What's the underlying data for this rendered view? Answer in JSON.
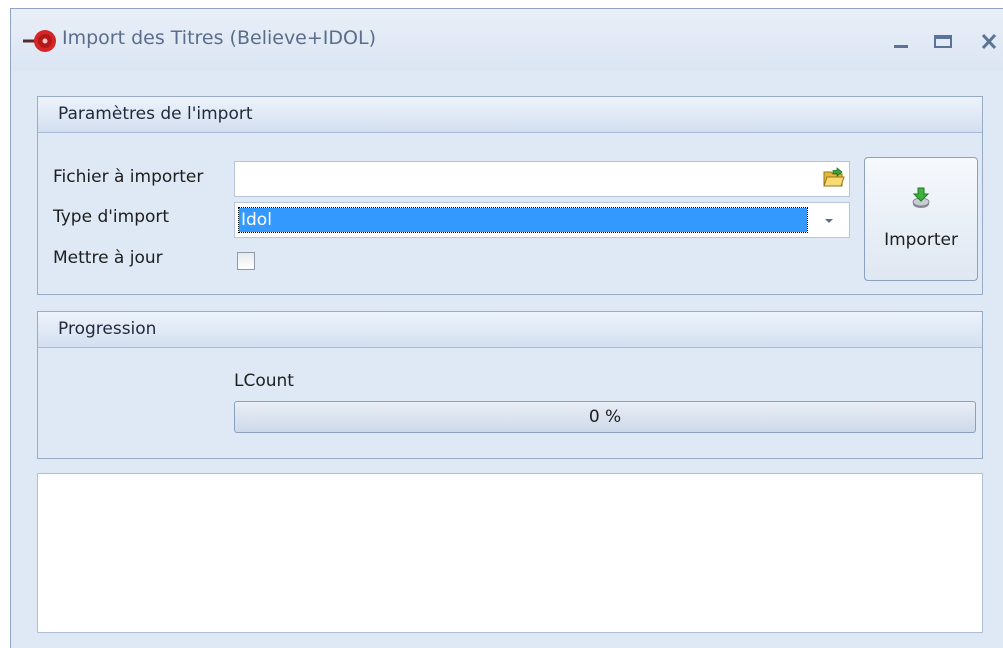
{
  "window": {
    "title": "Import des Titres (Believe+IDOL)",
    "icon": "red-record-icon",
    "controls": [
      "minimize-icon",
      "maximize-icon",
      "close-icon"
    ]
  },
  "params_panel": {
    "title": "Paramètres de l'import",
    "file_label": "Fichier à importer",
    "file_value": "",
    "type_label": "Type d'import",
    "type_value": "Idol",
    "update_label": "Mettre à jour",
    "update_checked": false,
    "import_button": "Importer"
  },
  "progress_panel": {
    "title": "Progression",
    "count_label": "LCount",
    "progress_text": "0 %",
    "progress_value": 0
  },
  "log": {
    "text": ""
  },
  "colors": {
    "window_bg": "#dfe8f5",
    "selection": "#3399ff",
    "title_text": "#5a6e8c"
  }
}
